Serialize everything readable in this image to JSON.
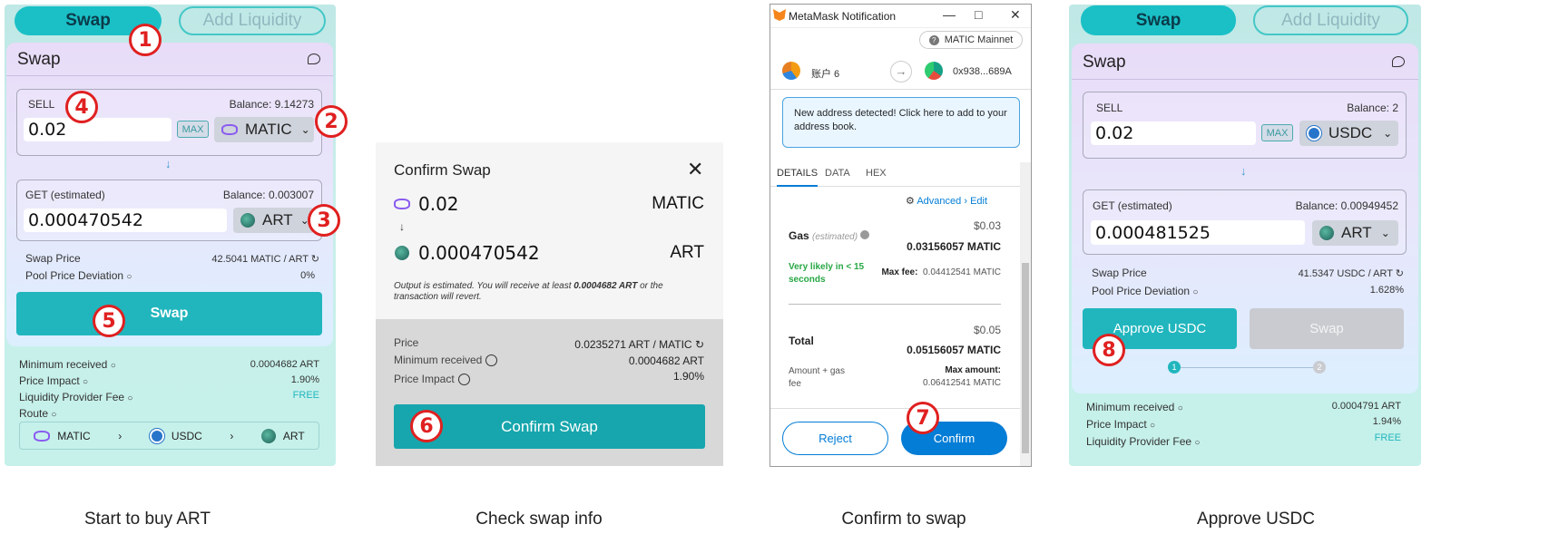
{
  "panel1": {
    "tab_swap": "Swap",
    "tab_add_liquidity": "Add Liquidity",
    "title": "Swap",
    "sell_label": "SELL",
    "sell_balance": "Balance: 9.14273",
    "sell_amount": "0.02",
    "max": "MAX",
    "sell_token": "MATIC",
    "get_label": "GET (estimated)",
    "get_balance": "Balance: 0.003007",
    "get_amount": "0.000470542",
    "get_token": "ART",
    "swap_price_label": "Swap Price",
    "swap_price_value": "42.5041 MATIC / ART",
    "pool_dev_label": "Pool Price Deviation",
    "pool_dev_value": "0%",
    "swap_button": "Swap",
    "min_received_label": "Minimum received",
    "min_received_value": "0.0004682 ART",
    "price_impact_label": "Price Impact",
    "price_impact_value": "1.90%",
    "lp_fee_label": "Liquidity Provider Fee",
    "lp_fee_value": "FREE",
    "route_label": "Route",
    "route": [
      "MATIC",
      "USDC",
      "ART"
    ],
    "caption": "Start to buy ART"
  },
  "panel2": {
    "title": "Confirm Swap",
    "from_amount": "0.02",
    "from_token": "MATIC",
    "to_amount": "0.000470542",
    "to_token": "ART",
    "note_prefix": "Output is estimated. You will receive at least ",
    "note_amount": "0.0004682 ART",
    "note_suffix": " or the transaction will revert.",
    "price_label": "Price",
    "price_value": "0.0235271 ART / MATIC",
    "min_received_label": "Minimum received",
    "min_received_value": "0.0004682 ART",
    "price_impact_label": "Price Impact",
    "price_impact_value": "1.90%",
    "button": "Confirm Swap",
    "caption": "Check swap info"
  },
  "panel3": {
    "window_title": "MetaMask Notification",
    "network": "MATIC Mainnet",
    "account": "账户 6",
    "to_address": "0x938...689A",
    "notice": "New address detected! Click here to add to your address book.",
    "tabs": [
      "DETAILS",
      "DATA",
      "HEX"
    ],
    "advanced": "Advanced",
    "edit": "Edit",
    "gas_usd": "$0.03",
    "gas_label": "Gas",
    "gas_estimated": "(estimated)",
    "gas_matic": "0.03156057 MATIC",
    "likely": "Very likely in < 15 seconds",
    "max_fee_label": "Max fee:",
    "max_fee_value": "0.04412541 MATIC",
    "total_usd": "$0.05",
    "total_label": "Total",
    "total_matic": "0.05156057 MATIC",
    "amount_gas_label": "Amount + gas fee",
    "max_amount_label": "Max amount:",
    "max_amount_value": "0.06412541 MATIC",
    "reject": "Reject",
    "confirm": "Confirm",
    "caption": "Confirm to swap"
  },
  "panel4": {
    "tab_swap": "Swap",
    "tab_add_liquidity": "Add Liquidity",
    "title": "Swap",
    "sell_label": "SELL",
    "sell_balance": "Balance: 2",
    "sell_amount": "0.02",
    "max": "MAX",
    "sell_token": "USDC",
    "get_label": "GET (estimated)",
    "get_balance": "Balance: 0.00949452",
    "get_amount": "0.000481525",
    "get_token": "ART",
    "swap_price_label": "Swap Price",
    "swap_price_value": "41.5347 USDC / ART",
    "pool_dev_label": "Pool Price Deviation",
    "pool_dev_value": "1.628%",
    "approve_button": "Approve USDC",
    "swap_button": "Swap",
    "step1": "1",
    "step2": "2",
    "min_received_label": "Minimum received",
    "min_received_value": "0.0004791 ART",
    "price_impact_label": "Price Impact",
    "price_impact_value": "1.94%",
    "lp_fee_label": "Liquidity Provider Fee",
    "lp_fee_value": "FREE",
    "caption": "Approve USDC"
  },
  "badges": [
    "1",
    "2",
    "3",
    "4",
    "5",
    "6",
    "7",
    "8"
  ],
  "colors": {
    "teal": "#21b6be",
    "badge_red": "#e02020",
    "metamask_blue": "#037dd6"
  }
}
